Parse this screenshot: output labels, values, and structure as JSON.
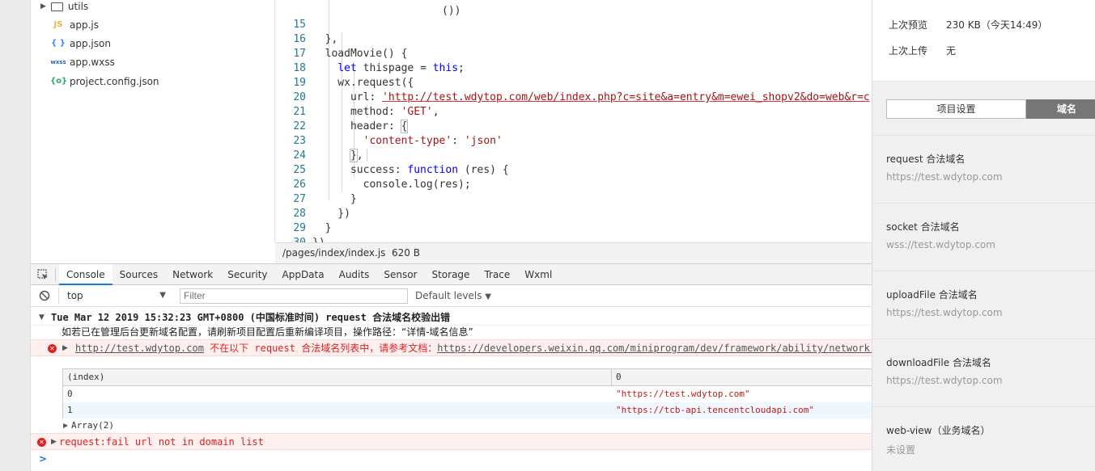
{
  "file_tree": {
    "items": [
      {
        "icon": "folder-icon",
        "label": "utils"
      },
      {
        "icon": "js-file-icon",
        "glyph": "JS",
        "label": "app.js"
      },
      {
        "icon": "json-file-icon",
        "glyph": "{ }",
        "label": "app.json"
      },
      {
        "icon": "wxss-file-icon",
        "glyph": "wxss",
        "label": "app.wxss"
      },
      {
        "icon": "config-file-icon",
        "glyph": "{o}",
        "label": "project.config.json"
      }
    ]
  },
  "editor": {
    "lines": [
      {
        "n": "15",
        "text": "  },"
      },
      {
        "n": "16",
        "text": "  loadMovie() {"
      },
      {
        "n": "17",
        "text": "    let thispage = this;"
      },
      {
        "n": "18",
        "text": "    wx.request({"
      },
      {
        "n": "19",
        "text": "      url: 'http://test.wdytop.com/web/index.php?c=site&a=entry&m=ewei_shopv2&do=web&r=c"
      },
      {
        "n": "20",
        "text": "      method: 'GET',"
      },
      {
        "n": "21",
        "text": "      header: {"
      },
      {
        "n": "22",
        "text": "        'content-type': 'json'"
      },
      {
        "n": "23",
        "text": "      },"
      },
      {
        "n": "24",
        "text": "      success: function (res) {"
      },
      {
        "n": "25",
        "text": "        console.log(res);"
      },
      {
        "n": "26",
        "text": "      }"
      },
      {
        "n": "27",
        "text": "    })"
      },
      {
        "n": "28",
        "text": "  }"
      },
      {
        "n": "29",
        "text": "})"
      },
      {
        "n": "30",
        "text": ""
      }
    ],
    "status_path": "/pages/index/index.js",
    "status_size": "620 B"
  },
  "devtools": {
    "tabs": [
      "Console",
      "Sources",
      "Network",
      "Security",
      "AppData",
      "Audits",
      "Sensor",
      "Storage",
      "Trace",
      "Wxml"
    ],
    "active_tab": "Console",
    "context": "top",
    "filter_placeholder": "Filter",
    "levels": "Default levels"
  },
  "console": {
    "group_header": "Tue Mar 12 2019 15:32:23 GMT+0800 (中国标准时间) request 合法域名校验出错",
    "info_line": "如若已在管理后台更新域名配置，请刷新项目配置后重新编译项目，操作路径：“详情-域名信息”",
    "error_url": "http://test.wdytop.com",
    "error_msg": " 不在以下 request 合法域名列表中，请参考文档：",
    "error_doc": "https://developers.weixin.qq.com/miniprogram/dev/framework/ability/network.html",
    "table": {
      "headers": [
        "(index)",
        "0"
      ],
      "rows": [
        [
          "0",
          "\"https://test.wdytop.com\""
        ],
        [
          "1",
          "\"https://tcb-api.tencentcloudapi.com\""
        ]
      ]
    },
    "array_label": "Array(2)",
    "fail_msg": "request:fail url not in domain list",
    "prompt": ">"
  },
  "settings": {
    "rows": [
      {
        "label": "上次预览",
        "value": "230 KB（今天14:49）"
      },
      {
        "label": "上次上传",
        "value": "无"
      }
    ],
    "tabs": [
      "项目设置",
      "域名"
    ],
    "domains": [
      {
        "title": "request 合法域名",
        "value": "https://test.wdytop.com"
      },
      {
        "title": "socket 合法域名",
        "value": "wss://test.wdytop.com"
      },
      {
        "title": "uploadFile 合法域名",
        "value": "https://test.wdytop.com"
      },
      {
        "title": "downloadFile 合法域名",
        "value": "https://test.wdytop.com"
      },
      {
        "title": "web-view（业务域名）",
        "value": "未设置"
      }
    ]
  },
  "colors": {
    "error_text": "#e02020",
    "error_bg": "#fff0f0",
    "active_tab_dark": "#777777",
    "accent_blue": "#1a73e8"
  }
}
